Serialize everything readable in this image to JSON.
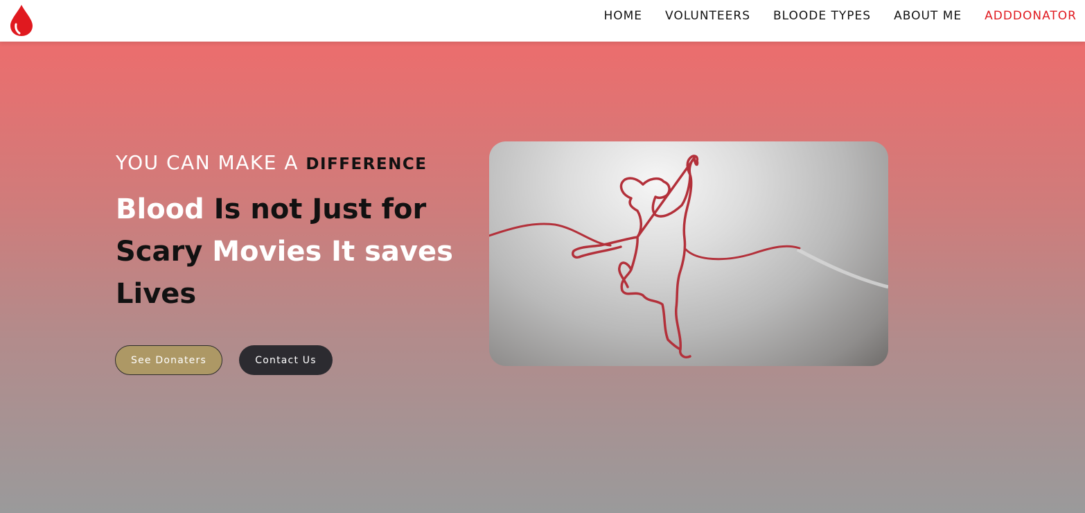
{
  "header": {
    "logo_icon": "blood-drop-icon",
    "nav": [
      {
        "label": "HOME"
      },
      {
        "label": "VOLUNTEERS"
      },
      {
        "label": "BLOODE TYPES"
      },
      {
        "label": "ABOUT ME"
      },
      {
        "label": "ADDDONATOR",
        "color": "#e0191f"
      }
    ]
  },
  "hero": {
    "kicker_main": "YOU CAN MAKE A",
    "kicker_emphasis": "DIFFERENCE",
    "headline": {
      "w1": "Blood",
      "d1": "Is not Just for",
      "d2": "Scary",
      "w2": "Movies It saves",
      "d3": "Lives"
    },
    "buttons": {
      "primary": "See Donaters",
      "secondary": "Contact Us"
    },
    "image_icon": "blood-tube-child-silhouette-icon"
  },
  "colors": {
    "brand_red": "#e0191f",
    "button_gold": "#ad9865",
    "button_dark": "#2c2b30"
  }
}
